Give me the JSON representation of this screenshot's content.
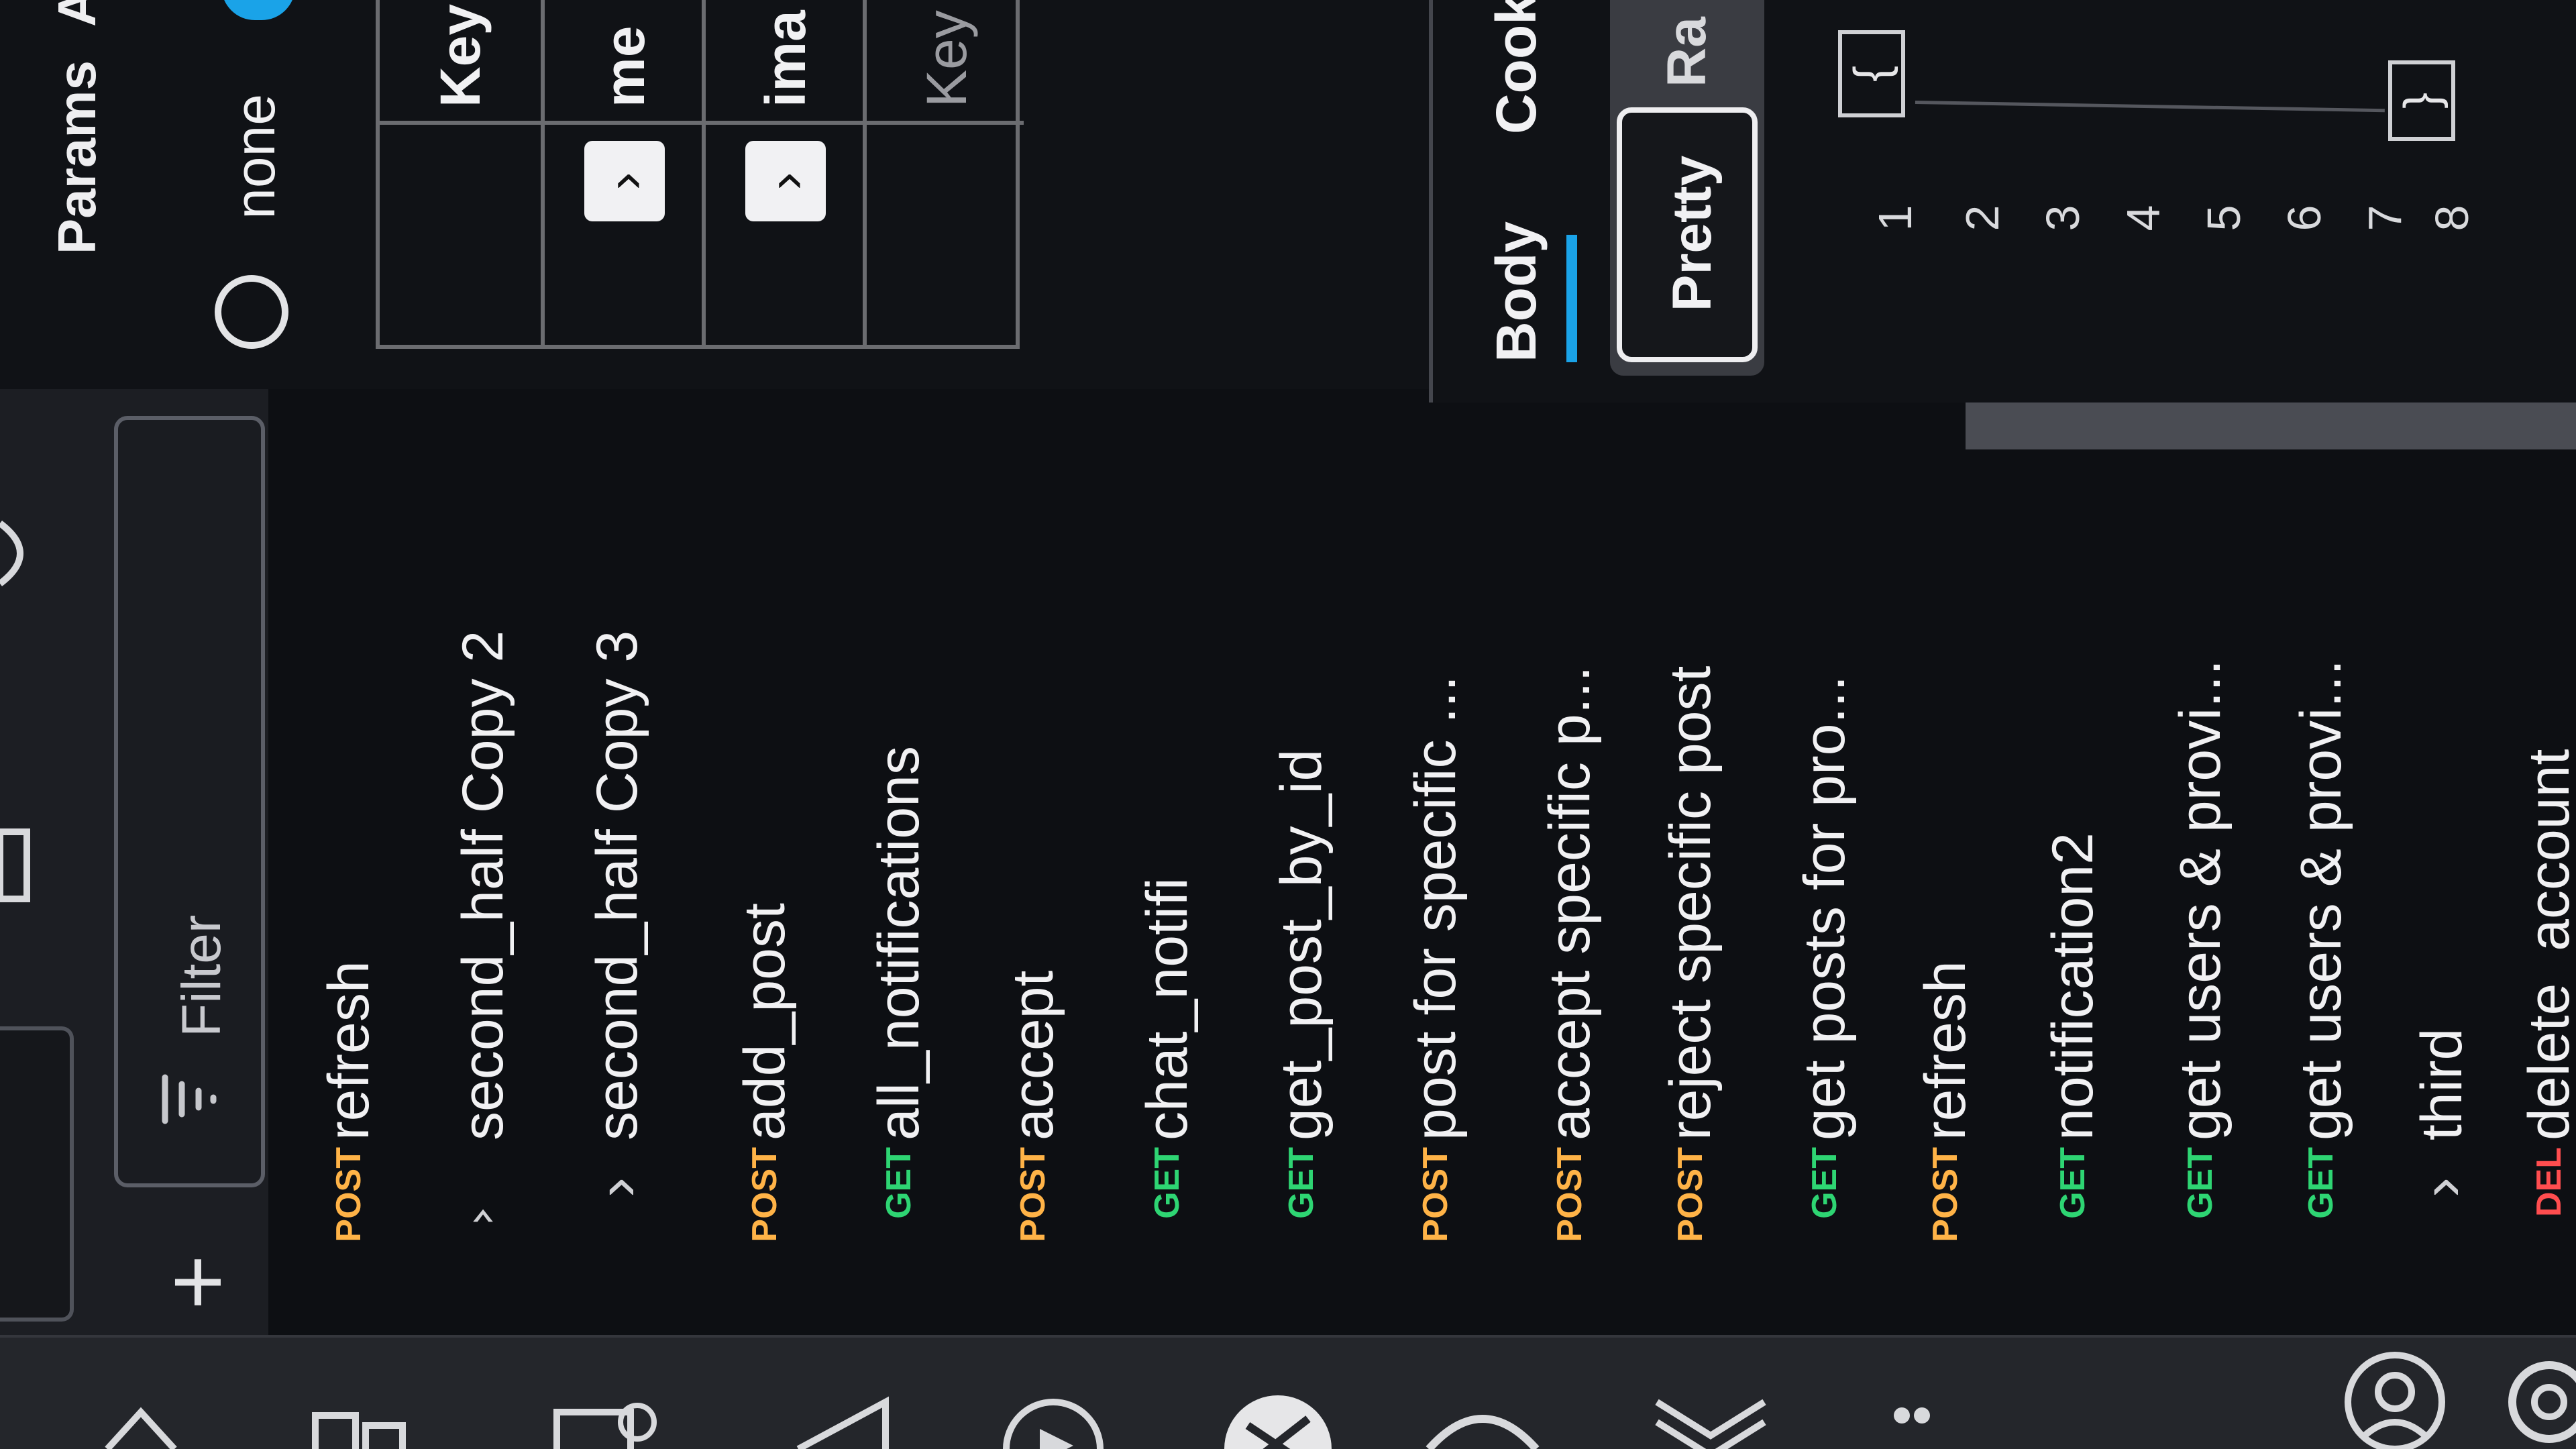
{
  "sidebar": {
    "new_label": "+",
    "filter_placeholder": "Filter",
    "items": [
      {
        "kind": "request",
        "method": "POST",
        "name": "refresh"
      },
      {
        "kind": "folder",
        "expanded": true,
        "name": "second_half Copy 2"
      },
      {
        "kind": "folder",
        "expanded": false,
        "name": "second_half Copy 3"
      },
      {
        "kind": "request",
        "method": "POST",
        "name": "add_post"
      },
      {
        "kind": "request",
        "method": "GET",
        "name": "all_notifications"
      },
      {
        "kind": "request",
        "method": "POST",
        "name": "accept"
      },
      {
        "kind": "request",
        "method": "GET",
        "name": "chat_notifi"
      },
      {
        "kind": "request",
        "method": "GET",
        "name": "get_post_by_id"
      },
      {
        "kind": "request",
        "method": "POST",
        "name": "post for specific ..."
      },
      {
        "kind": "request",
        "method": "POST",
        "name": "accept specific p..."
      },
      {
        "kind": "request",
        "method": "POST",
        "name": "reject specific post"
      },
      {
        "kind": "request",
        "method": "GET",
        "name": "get posts for pro..."
      },
      {
        "kind": "request",
        "method": "POST",
        "name": "refresh"
      },
      {
        "kind": "request",
        "method": "GET",
        "name": "notification2"
      },
      {
        "kind": "request",
        "method": "GET",
        "name": "get users & provi..."
      },
      {
        "kind": "request",
        "method": "GET",
        "name": "get users & provi..."
      },
      {
        "kind": "folder",
        "expanded": false,
        "name": "third"
      },
      {
        "kind": "request",
        "method": "DEL",
        "name": "delete_account"
      }
    ]
  },
  "request": {
    "tabs": [
      "Params",
      "A"
    ],
    "body_radio_label": "none",
    "table_headers": [
      "Key"
    ],
    "table_rows": [
      {
        "checked": true,
        "key": "me"
      },
      {
        "checked": true,
        "key": "ima"
      }
    ],
    "table_placeholder": "Key"
  },
  "response": {
    "tabs": [
      "Body",
      "Cook"
    ],
    "active_tab": "Body",
    "view_modes": [
      "Pretty",
      "Ra"
    ],
    "active_view": "Pretty",
    "line_numbers": [
      "1",
      "2",
      "3",
      "4",
      "5",
      "6",
      "7",
      "8"
    ],
    "code_first_line": "{",
    "code_last_line": "}"
  },
  "colors": {
    "post": "#ffb347",
    "get": "#2ed573",
    "del": "#ff4d4f",
    "accent": "#1aa3e8"
  }
}
